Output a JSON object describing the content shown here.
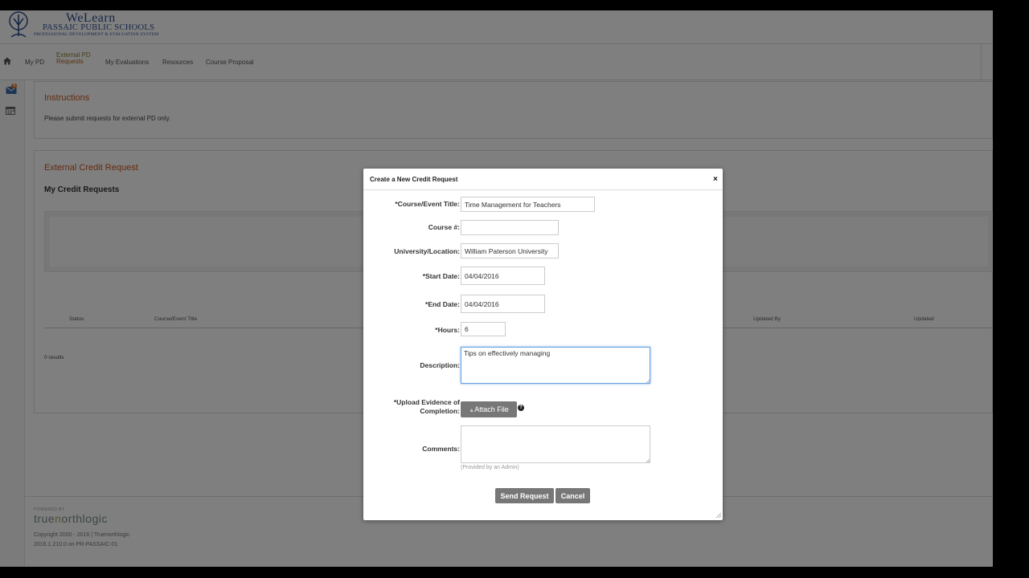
{
  "brand": {
    "line1": "WeLearn",
    "line2": "PASSAIC PUBLIC SCHOOLS",
    "line3": "PROFESSIONAL DEVELOPMENT & EVALUATION SYSTEM"
  },
  "nav": {
    "home_icon": "home-icon",
    "items": [
      {
        "label": "My PD"
      },
      {
        "label_line1": "External PD",
        "label_line2": "Requests",
        "active": true
      },
      {
        "label": "My Evaluations"
      },
      {
        "label": "Resources"
      },
      {
        "label": "Course Proposal"
      }
    ]
  },
  "sidebar": {
    "mail_icon": "mail-icon",
    "mail_badge": "5",
    "calendar_icon": "calendar-icon"
  },
  "instructions": {
    "title": "Instructions",
    "text": "Please submit requests for external PD only."
  },
  "credit": {
    "title": "External Credit Request",
    "subtitle": "My Credit Requests",
    "columns": [
      "Status",
      "Course/Event Title",
      "Updated By",
      "Updated"
    ],
    "results": "0 results"
  },
  "footer": {
    "powered": "POWERED BY",
    "logo_pre": "true",
    "logo_o": "n",
    "logo_post": "orthlogic",
    "copyright": "Copyright 2000 - 2016 | Truenorthlogic",
    "version": "2016.1.210.0 on PR-PASSAIC-01"
  },
  "modal": {
    "title": "Create a New Credit Request",
    "close": "×",
    "fields": {
      "course_title": {
        "label": "*Course/Event Title:",
        "value": "Time Management for Teachers"
      },
      "course_num": {
        "label": "Course #:",
        "value": ""
      },
      "location": {
        "label": "University/Location:",
        "value": "William Paterson University"
      },
      "start_date": {
        "label": "*Start Date:",
        "value": "04/04/2016"
      },
      "end_date": {
        "label": "*End Date:",
        "value": "04/04/2016"
      },
      "hours": {
        "label": "*Hours:",
        "value": "6"
      },
      "description": {
        "label": "Description:",
        "value": "Tips on effectively managing"
      },
      "upload": {
        "label_line1": "*Upload Evidence of",
        "label_line2": "Completion:",
        "button": "Attach File",
        "help": "?"
      },
      "comments": {
        "label": "Comments:",
        "value": "",
        "hint": "(Provided by an Admin)"
      }
    },
    "send_button": "Send Request",
    "cancel_button": "Cancel"
  }
}
